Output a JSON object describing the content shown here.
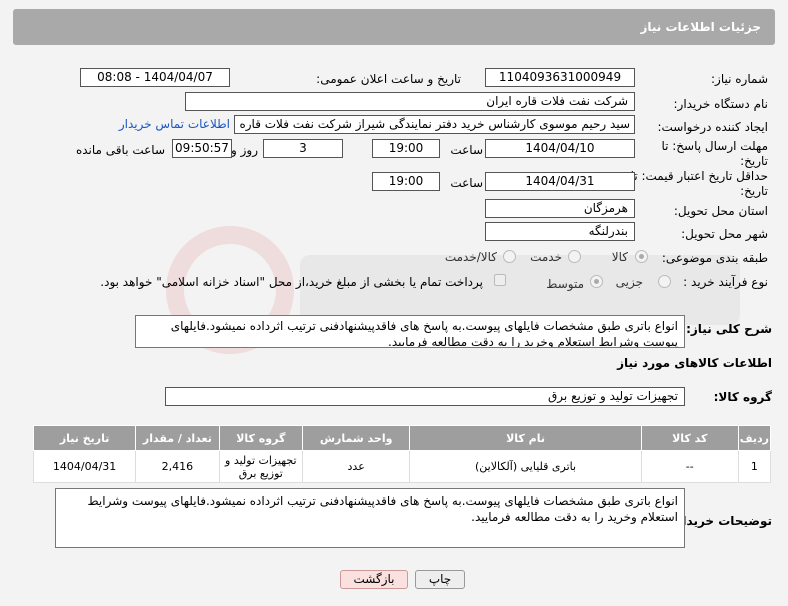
{
  "header": {
    "title": "جزئیات اطلاعات نیاز"
  },
  "fields": {
    "need_number_label": "شماره نیاز:",
    "need_number": "1104093631000949",
    "announce_label": "تاریخ و ساعت اعلان عمومی:",
    "announce_value": "1404/04/07 - 08:08",
    "buyer_org_label": "نام دستگاه خریدار:",
    "buyer_org": "شرکت نفت فلات قاره ایران",
    "creator_label": "ایجاد کننده درخواست:",
    "creator": "سید رحیم موسوی کارشناس خرید دفتر نمایندگی شیراز شرکت نفت فلات قاره ا",
    "contact_link": "اطلاعات تماس خریدار",
    "reply_deadline_label": "مهلت ارسال پاسخ: تا تاریخ:",
    "reply_date": "1404/04/10",
    "time_label": "ساعت",
    "reply_time": "19:00",
    "days_value": "3",
    "days_label": "روز و",
    "remaining_time": "09:50:57",
    "remaining_label": "ساعت باقی مانده",
    "price_validity_label": "حداقل تاریخ اعتبار قیمت: تا تاریخ:",
    "price_date": "1404/04/31",
    "price_time": "19:00",
    "province_label": "استان محل تحویل:",
    "province": "هرمزگان",
    "city_label": "شهر محل تحویل:",
    "city": "بندرلنگه",
    "category_label": "طبقه بندی موضوعی:",
    "category_options": [
      "کالا",
      "خدمت",
      "کالا/خدمت"
    ],
    "process_label": "نوع فرآیند خرید :",
    "process_options": [
      "جزیی",
      "متوسط"
    ],
    "payment_note": "پرداخت تمام یا بخشی از مبلغ خرید،از محل \"اسناد خزانه اسلامی\" خواهد بود."
  },
  "summary": {
    "label": "شرح کلی نیاز:",
    "text": "انواع باتری طبق مشخصات فایلهای پیوست.به پاسخ های فاقدپیشنهادفنی ترتیب اثرداده نمیشود.فایلهای پیوست وشرایط استعلام وخرید را به دقت مطالعه فرمایید."
  },
  "goods": {
    "section_title": "اطلاعات کالاهای مورد نیاز",
    "group_label": "گروه کالا:",
    "group_value": "تجهیزات تولید و توزیع برق",
    "columns": [
      "ردیف",
      "کد کالا",
      "نام کالا",
      "واحد شمارش",
      "گروه کالا",
      "تعداد / مقدار",
      "تاریخ نیاز"
    ],
    "rows": [
      [
        "1",
        "--",
        "باتری قلیایی (آلکالاین)",
        "عدد",
        "تجهیزات تولید و توزیع برق",
        "2,416",
        "1404/04/31"
      ]
    ]
  },
  "buyer_notes": {
    "label": "توضیحات خریدار:",
    "text": "انواع باتری طبق مشخصات فایلهای پیوست.به پاسخ های فاقدپیشنهادفنی ترتیب اثرداده نمیشود.فایلهای پیوست وشرایط استعلام وخرید را به دقت مطالعه فرمایید."
  },
  "buttons": {
    "print": "چاپ",
    "back": "بازگشت"
  },
  "colors": {
    "header_bg": "#a9a9a9",
    "table_header_bg": "#9e9e9e",
    "link": "#1a56c4"
  }
}
